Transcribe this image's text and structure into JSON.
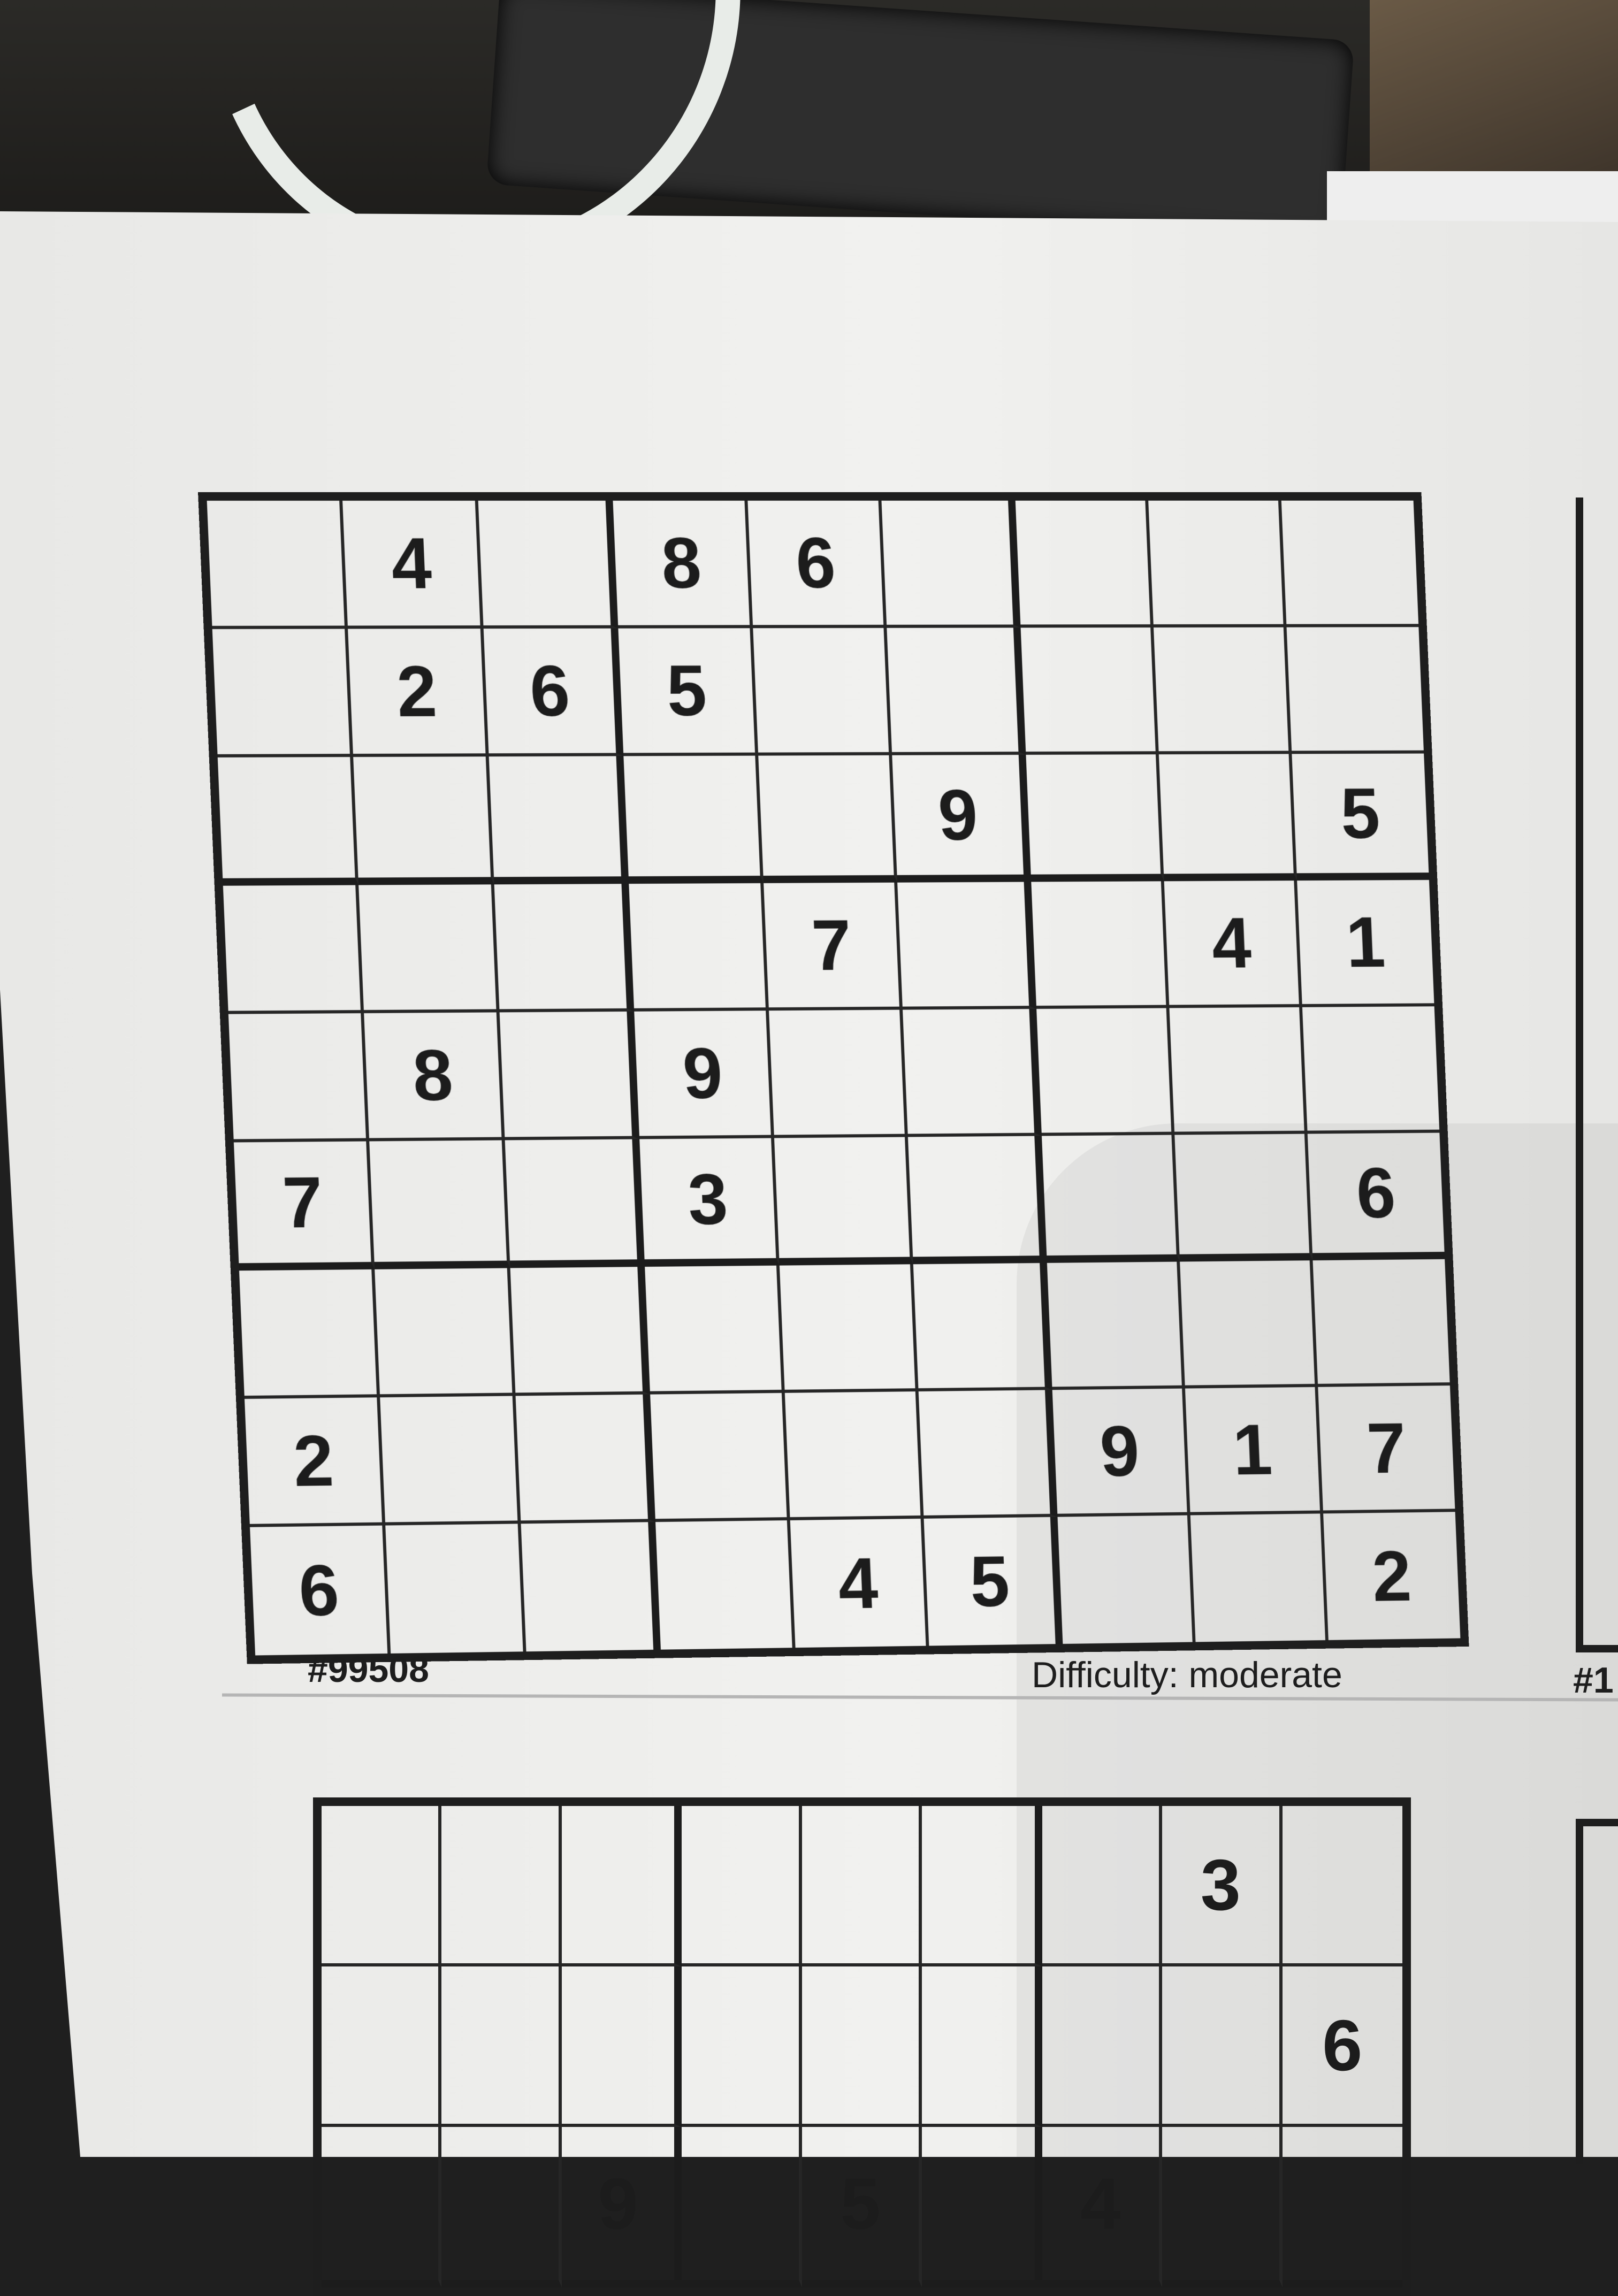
{
  "puzzle_1": {
    "id_label": "#99508",
    "difficulty_label": "Difficulty: moderate",
    "rows": [
      [
        "",
        "4",
        "",
        "8",
        "6",
        "",
        "",
        "",
        ""
      ],
      [
        "",
        "2",
        "6",
        "5",
        "",
        "",
        "",
        "",
        ""
      ],
      [
        "",
        "",
        "",
        "",
        "",
        "9",
        "",
        "",
        "5"
      ],
      [
        "",
        "",
        "",
        "",
        "7",
        "",
        "",
        "4",
        "1"
      ],
      [
        "",
        "8",
        "",
        "9",
        "",
        "",
        "",
        "",
        ""
      ],
      [
        "7",
        "",
        "",
        "3",
        "",
        "",
        "",
        "",
        "6"
      ],
      [
        "",
        "",
        "",
        "",
        "",
        "",
        "",
        "",
        ""
      ],
      [
        "2",
        "",
        "",
        "",
        "",
        "",
        "9",
        "1",
        "7"
      ],
      [
        "6",
        "",
        "",
        "",
        "4",
        "5",
        "",
        "",
        "2"
      ]
    ]
  },
  "puzzle_2": {
    "rows": [
      [
        "",
        "",
        "",
        "",
        "",
        "",
        "",
        "3",
        ""
      ],
      [
        "",
        "",
        "",
        "",
        "",
        "",
        "",
        "",
        "6"
      ],
      [
        "",
        "",
        "9",
        "",
        "5",
        "",
        "4",
        "",
        ""
      ]
    ]
  },
  "side_fragment": {
    "label": "#1"
  }
}
